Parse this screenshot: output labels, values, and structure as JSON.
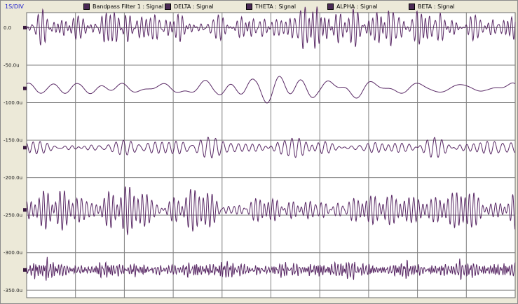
{
  "timebase_label": "1S/DIV",
  "legend": [
    {
      "label": "Bandpass Filter 1 : Signal"
    },
    {
      "label": "DELTA : Signal"
    },
    {
      "label": "THETA : Signal"
    },
    {
      "label": "ALPHA : Signal"
    },
    {
      "label": "BETA : Signal"
    }
  ],
  "colors": {
    "trace": "#5a2a66",
    "grid": "#7f7f7f",
    "plot_bg": "#ffffff",
    "window_bg": "#ece9d8",
    "marker": "#3a1a40"
  },
  "chart_data": {
    "type": "line",
    "title": "",
    "xlabel": "",
    "ylabel": "",
    "x_divisions": 10,
    "x_seconds_per_div": 1,
    "ylim": [
      -360,
      20
    ],
    "yticks": [
      {
        "value": 0,
        "label": "0.0"
      },
      {
        "value": -50,
        "label": "-50.0u"
      },
      {
        "value": -100,
        "label": "-100.0u"
      },
      {
        "value": -150,
        "label": "-150.0u"
      },
      {
        "value": -200,
        "label": "-200.0u"
      },
      {
        "value": -250,
        "label": "-250.0u"
      },
      {
        "value": -300,
        "label": "-300.0u"
      },
      {
        "value": -350,
        "label": "-350.0u"
      }
    ],
    "grid": true,
    "series": [
      {
        "name": "Bandpass Filter 1 : Signal",
        "baseline": 0,
        "amplitude": 22,
        "band_hz": [
          8,
          14
        ]
      },
      {
        "name": "DELTA : Signal",
        "baseline": -81,
        "amplitude": 14,
        "band_hz": [
          1,
          3
        ]
      },
      {
        "name": "THETA : Signal",
        "baseline": -160,
        "amplitude": 12,
        "band_hz": [
          5,
          8
        ]
      },
      {
        "name": "ALPHA : Signal",
        "baseline": -243,
        "amplitude": 28,
        "band_hz": [
          8,
          12
        ]
      },
      {
        "name": "BETA : Signal",
        "baseline": -323,
        "amplitude": 10,
        "band_hz": [
          14,
          30
        ]
      }
    ]
  }
}
